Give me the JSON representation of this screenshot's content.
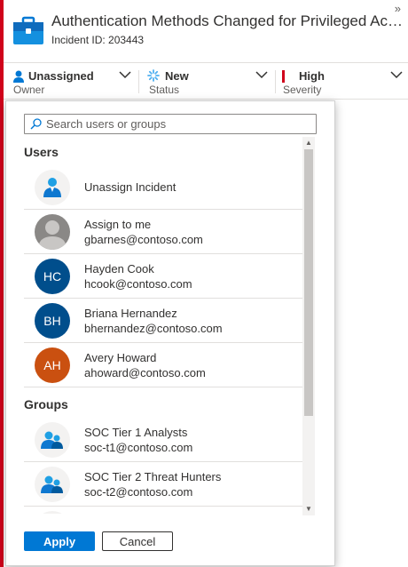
{
  "header": {
    "title": "Authentication Methods Changed for Privileged Acc...",
    "incident_id": "Incident ID: 203443",
    "expand_glyph": "»"
  },
  "fields": {
    "owner": {
      "value": "Unassigned",
      "label": "Owner"
    },
    "status": {
      "value": "New",
      "label": "Status"
    },
    "severity": {
      "value": "High",
      "label": "Severity"
    }
  },
  "search": {
    "placeholder": "Search users or groups"
  },
  "sections": {
    "users": "Users",
    "groups": "Groups"
  },
  "users": [
    {
      "line1": "Unassign Incident",
      "line2": ""
    },
    {
      "line1": "Assign to me",
      "line2": "gbarnes@contoso.com"
    },
    {
      "initials": "HC",
      "line1": "Hayden Cook",
      "line2": "hcook@contoso.com",
      "color": "#004e8c"
    },
    {
      "initials": "BH",
      "line1": "Briana Hernandez",
      "line2": "bhernandez@contoso.com",
      "color": "#004e8c"
    },
    {
      "initials": "AH",
      "line1": "Avery Howard",
      "line2": "ahoward@contoso.com",
      "color": "#ca5010"
    }
  ],
  "groups": [
    {
      "line1": "SOC Tier 1 Analysts",
      "line2": "soc-t1@contoso.com"
    },
    {
      "line1": "SOC Tier 2 Threat Hunters",
      "line2": "soc-t2@contoso.com"
    }
  ],
  "buttons": {
    "apply": "Apply",
    "cancel": "Cancel"
  },
  "colors": {
    "accent": "#0078d4",
    "severity_high": "#d0021b"
  }
}
